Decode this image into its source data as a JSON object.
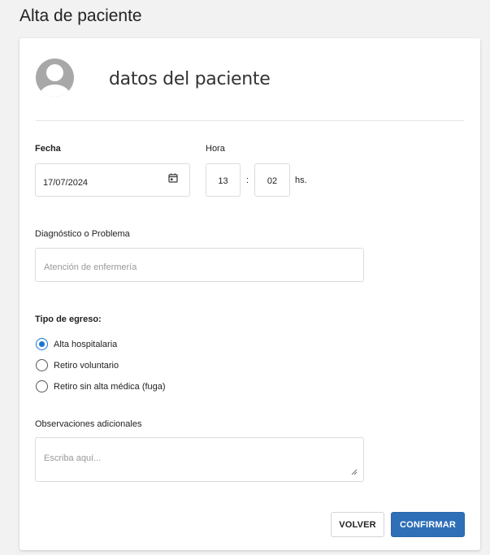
{
  "page": {
    "title": "Alta de paciente"
  },
  "card": {
    "header_title": "datos del paciente"
  },
  "fecha": {
    "label": "Fecha",
    "value": "17/07/2024"
  },
  "hora": {
    "label": "Hora",
    "hours": "13",
    "separator": ":",
    "minutes": "02",
    "suffix": "hs."
  },
  "diagnostico": {
    "label": "Diagnóstico o Problema",
    "placeholder": "Atención de enfermería"
  },
  "tipo_egreso": {
    "label": "Tipo de egreso:",
    "options": [
      {
        "label": "Alta hospitalaria",
        "selected": true
      },
      {
        "label": "Retiro voluntario",
        "selected": false
      },
      {
        "label": "Retiro sin alta médica (fuga)",
        "selected": false
      }
    ]
  },
  "observaciones": {
    "label": "Observaciones adicionales",
    "placeholder": "Escriba aquí..."
  },
  "actions": {
    "back_label": "VOLVER",
    "confirm_label": "CONFIRMAR"
  },
  "colors": {
    "accent": "#1976d2",
    "confirm_button": "#2e6fb7",
    "background": "#f2f2f3"
  },
  "icons": {
    "avatar": "user-avatar-icon",
    "calendar": "calendar-icon",
    "resize": "resize-handle-icon"
  }
}
